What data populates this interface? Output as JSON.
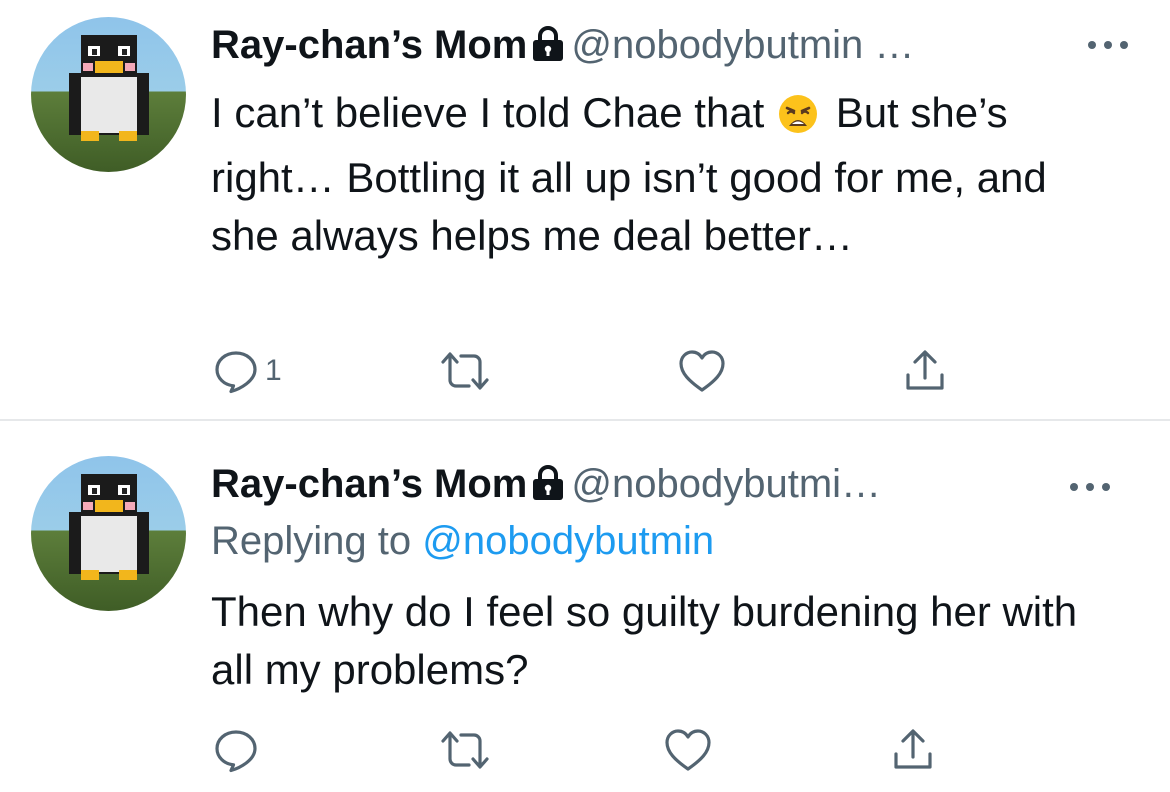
{
  "tweets": [
    {
      "display_name": "Ray-chan’s Mom",
      "handle": "@nobodybutmin …",
      "text_before_emoji": "I can’t believe I told Chae that",
      "emoji_name": "weary-face-emoji",
      "text_after_emoji": "But she’s right… Bottling it all up isn’t good for me, and she always helps me deal better…",
      "reply_count": "1"
    },
    {
      "display_name": "Ray-chan’s Mom",
      "handle": "@nobodybutmi…",
      "replying_prefix": "Replying to",
      "replying_mention": "@nobodybutmin",
      "text": "Then why do I feel so guilty burdening her with all my problems?"
    }
  ],
  "icons": {
    "reply": "speech-bubble-icon",
    "retweet": "retweet-icon",
    "like": "heart-icon",
    "share": "share-icon",
    "more": "ellipsis-icon",
    "lock": "lock-icon"
  },
  "colors": {
    "text": "#0f1419",
    "secondary": "#536471",
    "link": "#1d9bf0",
    "divider": "#e6e8ea"
  }
}
